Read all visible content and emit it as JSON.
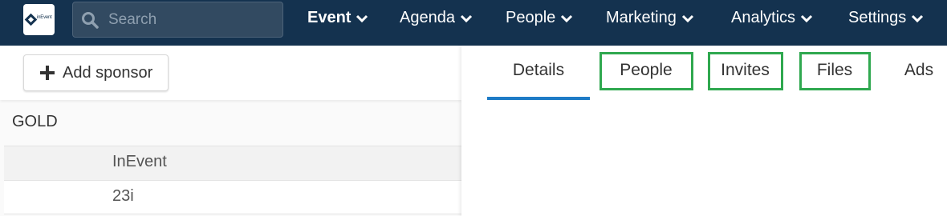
{
  "colors": {
    "navbar": "#14324f",
    "highlight": "#2fa84f",
    "active_tab": "#1e7bc6"
  },
  "logo": {
    "text": "inEvent",
    "icon": "inevent-logo-icon"
  },
  "search": {
    "placeholder": "Search",
    "icon": "search-icon"
  },
  "nav": {
    "items": [
      {
        "label": "Event",
        "active": true
      },
      {
        "label": "Agenda"
      },
      {
        "label": "People"
      },
      {
        "label": "Marketing"
      },
      {
        "label": "Analytics"
      },
      {
        "label": "Settings"
      }
    ]
  },
  "sponsors": {
    "add_label": "Add sponsor",
    "tier": "GOLD",
    "rows": [
      {
        "name": "InEvent"
      },
      {
        "name": "23i"
      }
    ]
  },
  "tabs": {
    "items": [
      {
        "label": "Details",
        "active": true
      },
      {
        "label": "People",
        "highlighted": true
      },
      {
        "label": "Invites",
        "highlighted": true
      },
      {
        "label": "Files",
        "highlighted": true
      },
      {
        "label": "Ads"
      }
    ]
  }
}
